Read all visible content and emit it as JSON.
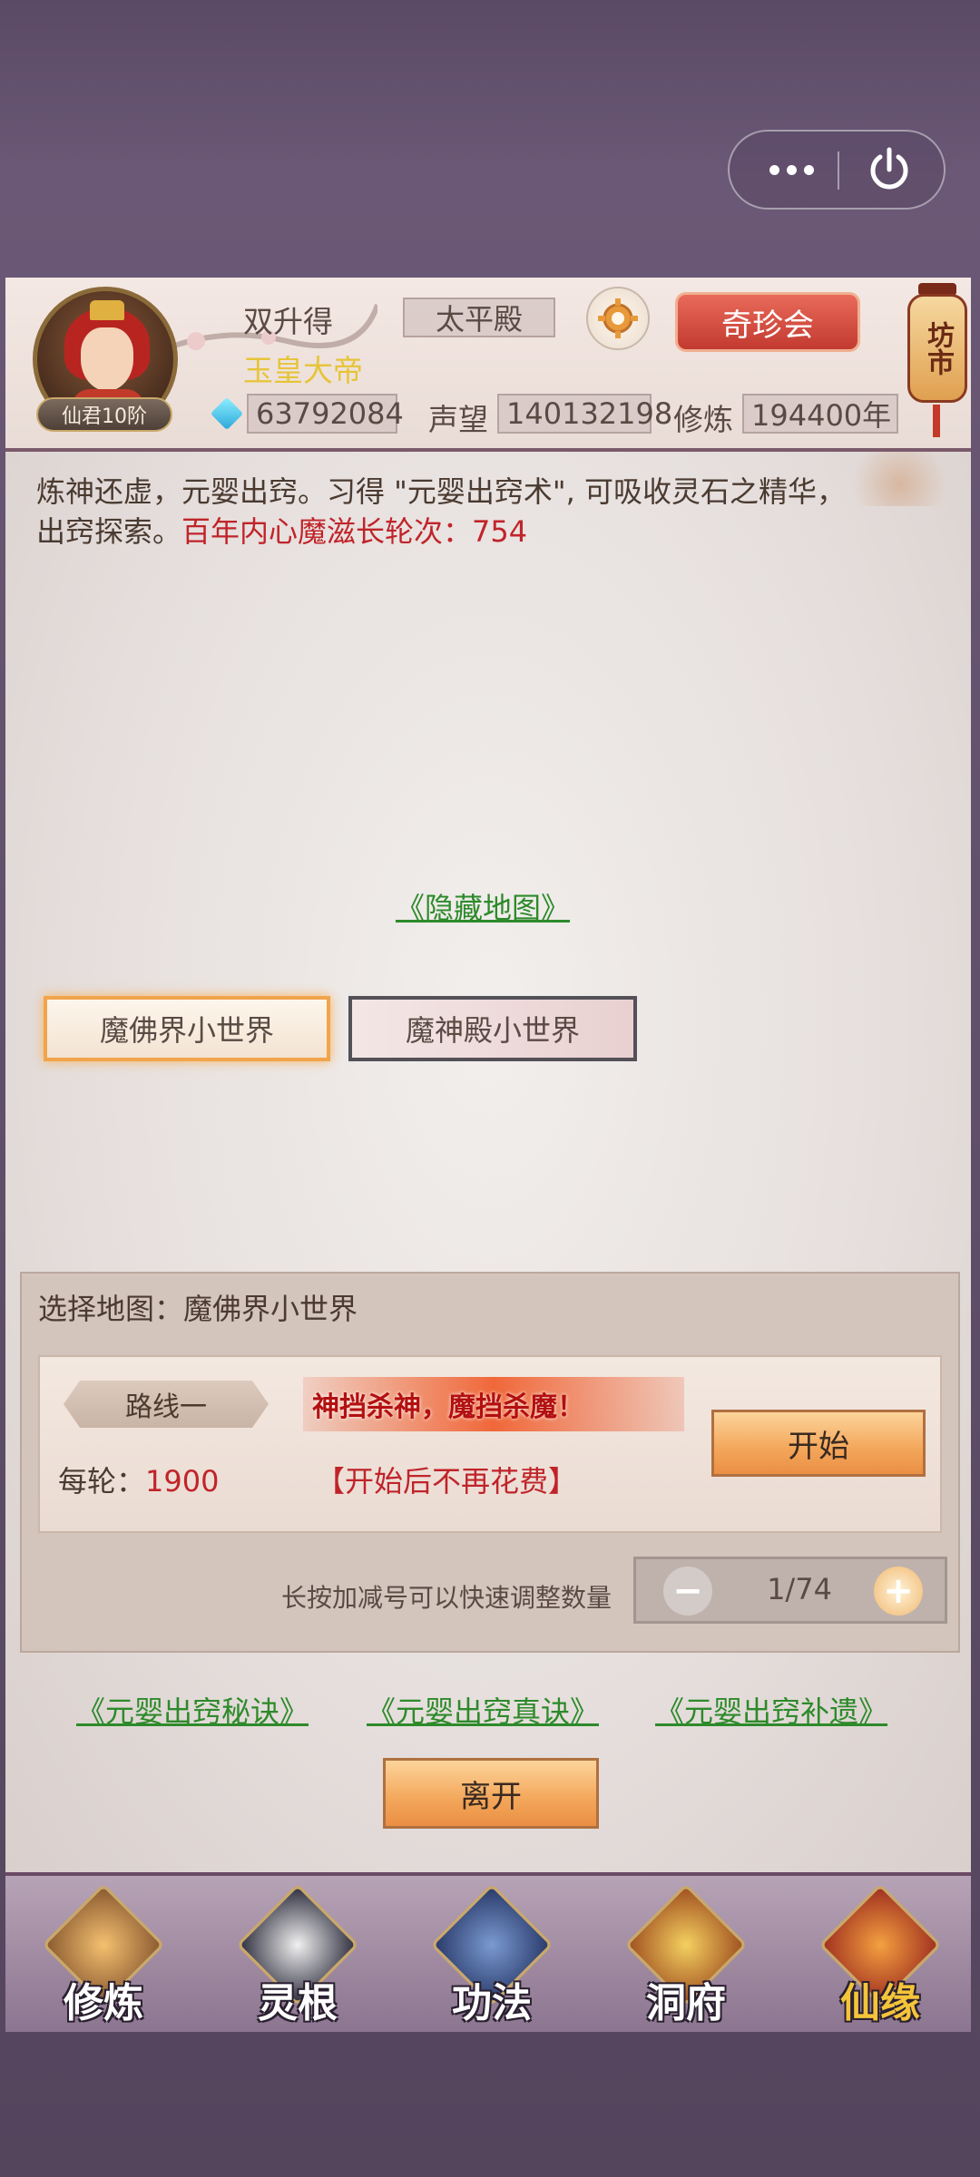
{
  "system": {
    "menu_icon": "more-dots-icon",
    "close_icon": "power-icon"
  },
  "player": {
    "name": "双升得",
    "title": "玉皇大帝",
    "rank": "仙君10阶",
    "location": "太平殿",
    "spirit_stones": "63792084",
    "reputation_label": "声望",
    "reputation": "140132198",
    "cultivation_label": "修炼",
    "cultivation": "194400年"
  },
  "header": {
    "treasure_button": "奇珍会",
    "market_lantern": "坊市"
  },
  "description": {
    "text": "炼神还虚，元婴出窍。习得 \"元婴出窍术\", 可吸收灵石之精华，出窍探索。",
    "highlight": "百年内心魔滋长轮次：754"
  },
  "hidden_map_link": "《隐藏地图》",
  "maps": [
    {
      "label": "魔佛界小世界",
      "selected": true
    },
    {
      "label": "魔神殿小世界",
      "selected": false
    }
  ],
  "selection": {
    "title": "选择地图：魔佛界小世界",
    "route_label": "路线一",
    "slogan": "神挡杀神，魔挡杀魔！",
    "cost_label": "每轮：",
    "cost_value": "1900",
    "free_note": "【开始后不再花费】",
    "start_button": "开始",
    "hint": "长按加减号可以快速调整数量",
    "count": "1/74"
  },
  "secret_links": [
    "《元婴出窍秘诀》",
    "《元婴出窍真诀》",
    "《元婴出窍补遗》"
  ],
  "leave_button": "离开",
  "nav": [
    {
      "label": "修炼",
      "icon": "meditating-monk-icon"
    },
    {
      "label": "灵根",
      "icon": "spirit-root-icon"
    },
    {
      "label": "功法",
      "icon": "scripture-book-icon"
    },
    {
      "label": "洞府",
      "icon": "cave-dwelling-icon"
    },
    {
      "label": "仙缘",
      "icon": "gourd-icon"
    }
  ],
  "colors": {
    "accent_red": "#c0242a",
    "link_green": "#2d8a2a",
    "gold": "#e6c43a",
    "orange": "#f3a65a"
  }
}
